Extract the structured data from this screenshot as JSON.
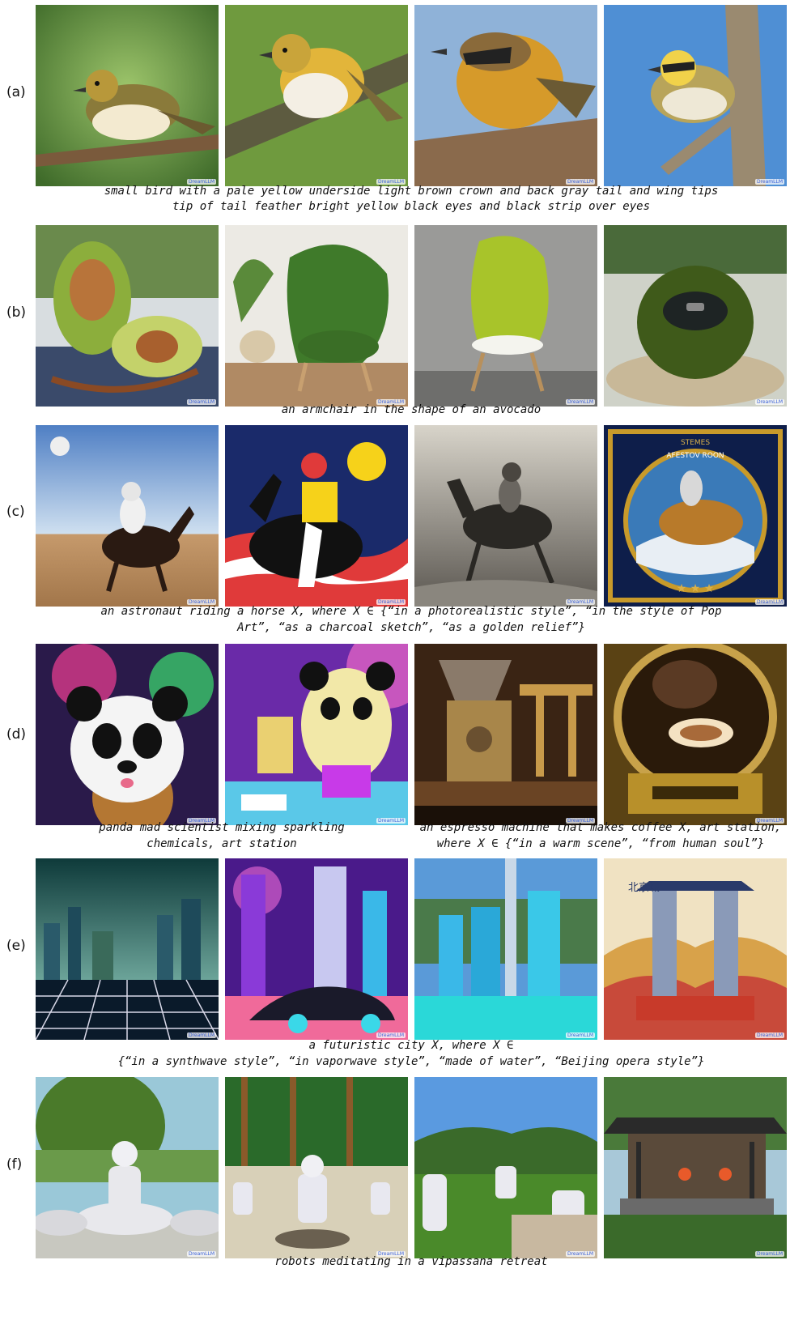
{
  "watermark": "DreamLLM",
  "rows": [
    {
      "label": "(a)",
      "captions": [
        "small bird with a pale yellow underside light brown crown and back gray tail and wing tips",
        "tip of tail feather bright yellow black eyes and black strip over eyes"
      ]
    },
    {
      "label": "(b)",
      "captions": [
        "an armchair in the shape of an avocado"
      ]
    },
    {
      "label": "(c)",
      "captions": [
        "an astronaut riding a horse X, where X ∈ {“in a photorealistic style”, “in the style of Pop",
        "Art”, “as a charcoal sketch”, “as a golden relief”}"
      ]
    },
    {
      "label": "(d)",
      "captions_left": [
        "panda mad scientist mixing sparkling",
        "chemicals, art station"
      ],
      "captions_right": [
        "an espresso machine that makes coffee X, art station,",
        "where X ∈ {“in a warm scene”, “from human soul”}"
      ]
    },
    {
      "label": "(e)",
      "captions": [
        "a futuristic city X, where X ∈",
        "{“in a synthwave style”, “in vaporwave style”, “made of water”, “Beijing opera style”}"
      ]
    },
    {
      "label": "(f)",
      "captions": [
        "robots meditating in a vipassana retreat"
      ]
    }
  ],
  "card_text": {
    "top": "STEMES",
    "sub": "AFESTOV ROON"
  },
  "poster_text": "北京城"
}
